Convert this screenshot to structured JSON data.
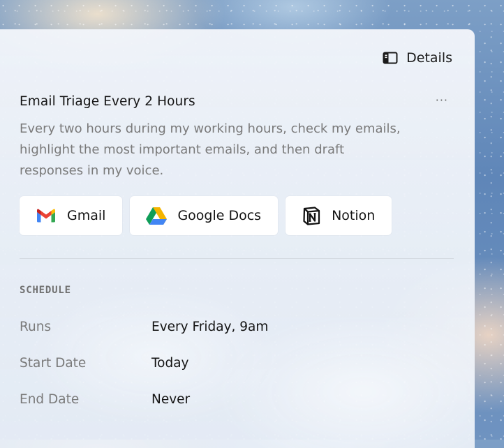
{
  "header": {
    "details_label": "Details",
    "details_icon": "sidebar-panel-icon"
  },
  "task": {
    "title": "Email Triage Every 2 Hours",
    "more_label": "···",
    "description": "Every two hours during my working hours, check my emails, highlight the most important emails, and then draft responses in my voice."
  },
  "integrations": [
    {
      "label": "Gmail",
      "icon": "gmail-icon"
    },
    {
      "label": "Google Docs",
      "icon": "google-drive-icon"
    },
    {
      "label": "Notion",
      "icon": "notion-icon"
    }
  ],
  "schedule": {
    "heading": "SCHEDULE",
    "rows": [
      {
        "key": "Runs",
        "value": "Every Friday, 9am"
      },
      {
        "key": "Start Date",
        "value": "Today"
      },
      {
        "key": "End Date",
        "value": "Never"
      }
    ]
  },
  "colors": {
    "gmail_red": "#EA4335",
    "gmail_blue": "#4285F4",
    "gmail_green": "#34A853",
    "gmail_yellow": "#FBBC04",
    "drive_green": "#0F9D58",
    "drive_yellow": "#F4B400",
    "drive_blue": "#4285F4"
  }
}
